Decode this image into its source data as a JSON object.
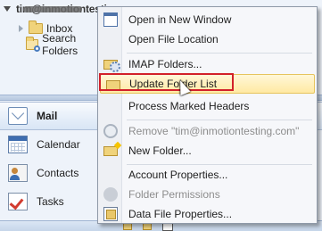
{
  "navigation": {
    "account_name": "tim@inmotiontesting.com",
    "folders": [
      {
        "label": "Inbox",
        "icon": "folder-icon"
      },
      {
        "label": "Search Folders",
        "icon": "search-folder-icon"
      }
    ],
    "modules": [
      {
        "label": "Mail",
        "icon": "mail-icon",
        "selected": true
      },
      {
        "label": "Calendar",
        "icon": "calendar-icon"
      },
      {
        "label": "Contacts",
        "icon": "contacts-icon"
      },
      {
        "label": "Tasks",
        "icon": "tasks-icon"
      }
    ]
  },
  "context_menu": {
    "items": [
      {
        "label": "Open in New Window",
        "icon": "window-icon"
      },
      {
        "label": "Open File Location",
        "icon": ""
      },
      {
        "label": "IMAP Folders...",
        "icon": "folder-gear-icon"
      },
      {
        "label": "Update Folder List",
        "icon": "folder-icon",
        "hovered": true
      },
      {
        "label": "Process Marked Headers",
        "icon": ""
      },
      {
        "label": "Remove \"tim@inmotiontesting.com\"",
        "icon": "remove-icon",
        "disabled": true
      },
      {
        "label": "New Folder...",
        "icon": "new-folder-icon"
      },
      {
        "label": "Account Properties...",
        "icon": ""
      },
      {
        "label": "Folder Permissions",
        "icon": "permissions-icon",
        "disabled": true
      },
      {
        "label": "Data File Properties...",
        "icon": "data-file-icon"
      }
    ]
  },
  "colors": {
    "highlight_border": "#d2202a",
    "hover_fill": "#ffe9a3",
    "nav_background": "#eef3fa"
  }
}
